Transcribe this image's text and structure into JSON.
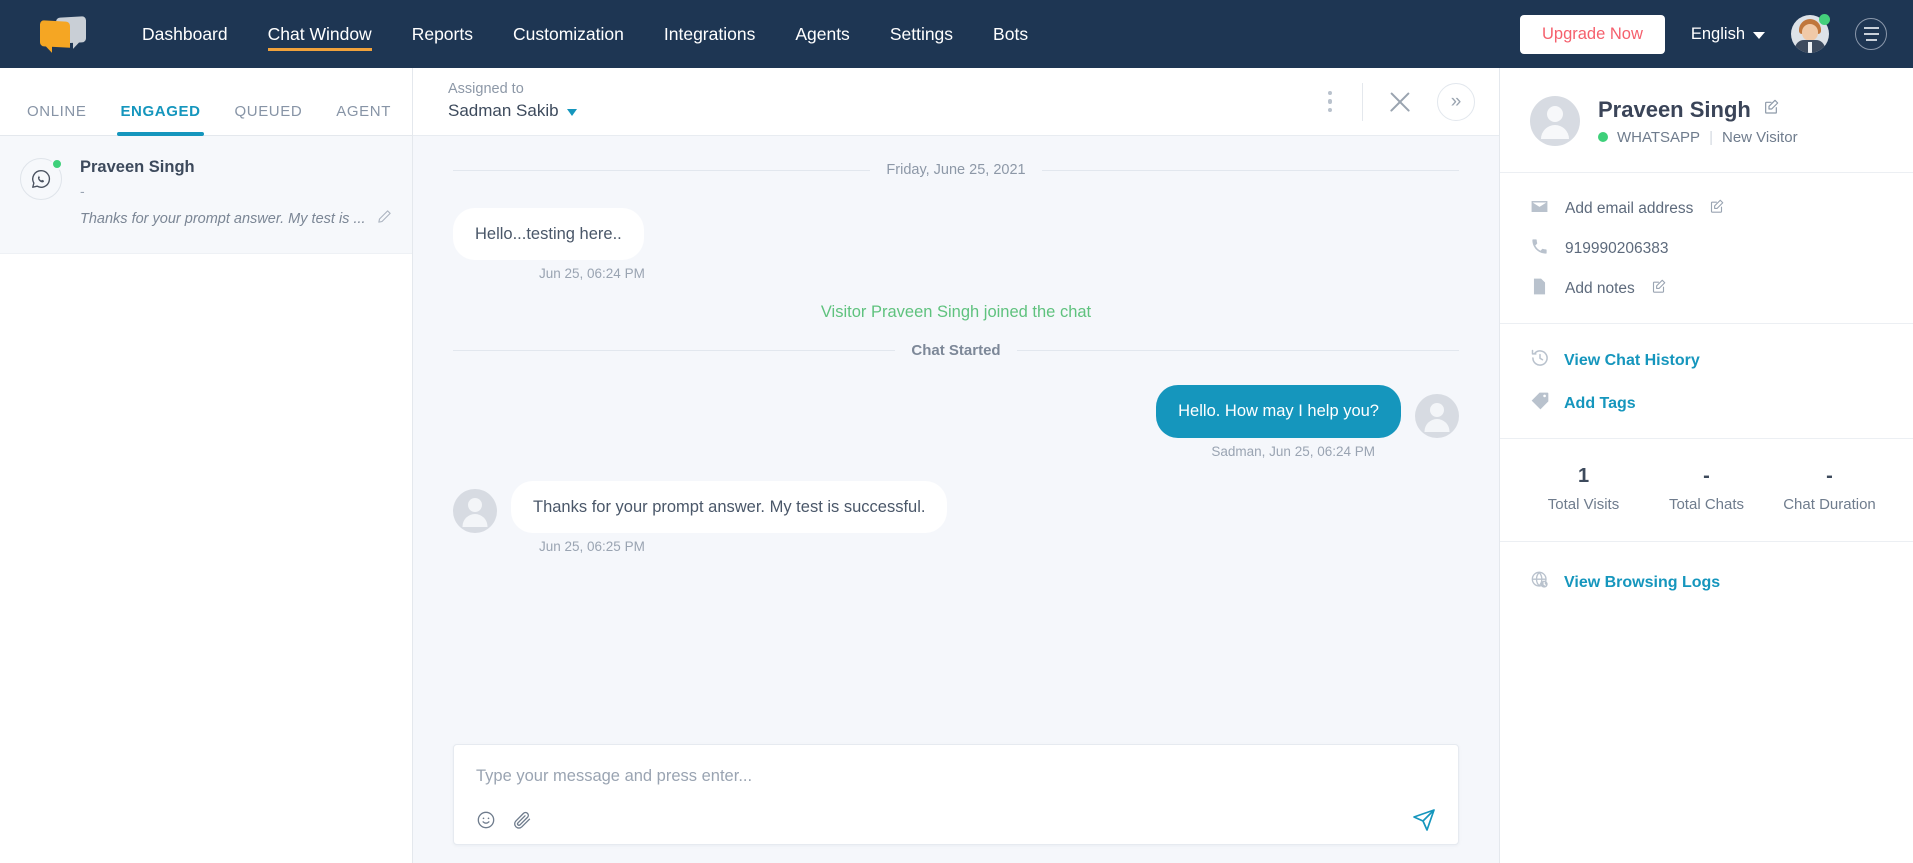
{
  "topnav": {
    "logo_name": "kapture-logo",
    "items": [
      {
        "label": "Dashboard",
        "active": false
      },
      {
        "label": "Chat Window",
        "active": true
      },
      {
        "label": "Reports",
        "active": false
      },
      {
        "label": "Customization",
        "active": false
      },
      {
        "label": "Integrations",
        "active": false
      },
      {
        "label": "Agents",
        "active": false
      },
      {
        "label": "Settings",
        "active": false
      },
      {
        "label": "Bots",
        "active": false
      }
    ],
    "upgrade_label": "Upgrade Now",
    "language": "English",
    "upgrade_color": "#f5606d",
    "bg_color": "#1e3653",
    "accent_color": "#f0a23c"
  },
  "left_panel": {
    "tabs": [
      {
        "label": "ONLINE",
        "active": false
      },
      {
        "label": "ENGAGED",
        "active": true
      },
      {
        "label": "QUEUED",
        "active": false
      },
      {
        "label": "AGENT",
        "active": false
      }
    ],
    "active_color": "#1596bd",
    "chats": [
      {
        "name": "Praveen Singh",
        "subtitle": "-",
        "preview": "Thanks for your prompt answer. My test is ...",
        "channel": "whatsapp",
        "online": true
      }
    ]
  },
  "chat_header": {
    "assigned_label": "Assigned to",
    "assigned_name": "Sadman Sakib"
  },
  "conversation": {
    "date_divider": "Friday, June 25, 2021",
    "system_join": "Visitor Praveen Singh joined the chat",
    "chat_started": "Chat Started",
    "messages": [
      {
        "side": "in",
        "text": "Hello...testing here..",
        "timestamp": "Jun 25, 06:24 PM",
        "show_avatar": false
      },
      {
        "side": "out",
        "text": "Hello. How may I help you?",
        "timestamp": "Sadman, Jun 25, 06:24 PM",
        "show_avatar": true
      },
      {
        "side": "in",
        "text": "Thanks for your prompt answer. My test is successful.",
        "timestamp": "Jun 25, 06:25 PM",
        "show_avatar": true
      }
    ]
  },
  "composer": {
    "placeholder": "Type your message and press enter...",
    "value": ""
  },
  "right_panel": {
    "visitor_name": "Praveen Singh",
    "channel": "WHATSAPP",
    "visitor_type": "New Visitor",
    "separator": "|",
    "info": [
      {
        "icon": "email-icon",
        "label": "Add email address",
        "editable": true
      },
      {
        "icon": "phone-icon",
        "label": "919990206383",
        "editable": false
      },
      {
        "icon": "notes-icon",
        "label": "Add notes",
        "editable": true
      }
    ],
    "links": [
      {
        "icon": "history-icon",
        "label": "View Chat History"
      },
      {
        "icon": "tag-icon",
        "label": "Add Tags"
      }
    ],
    "stats": [
      {
        "value": "1",
        "label": "Total Visits"
      },
      {
        "value": "-",
        "label": "Total Chats"
      },
      {
        "value": "-",
        "label": "Chat Duration"
      }
    ],
    "browsing_logs": {
      "icon": "globe-clock-icon",
      "label": "View Browsing Logs"
    },
    "link_color": "#1596bd"
  }
}
